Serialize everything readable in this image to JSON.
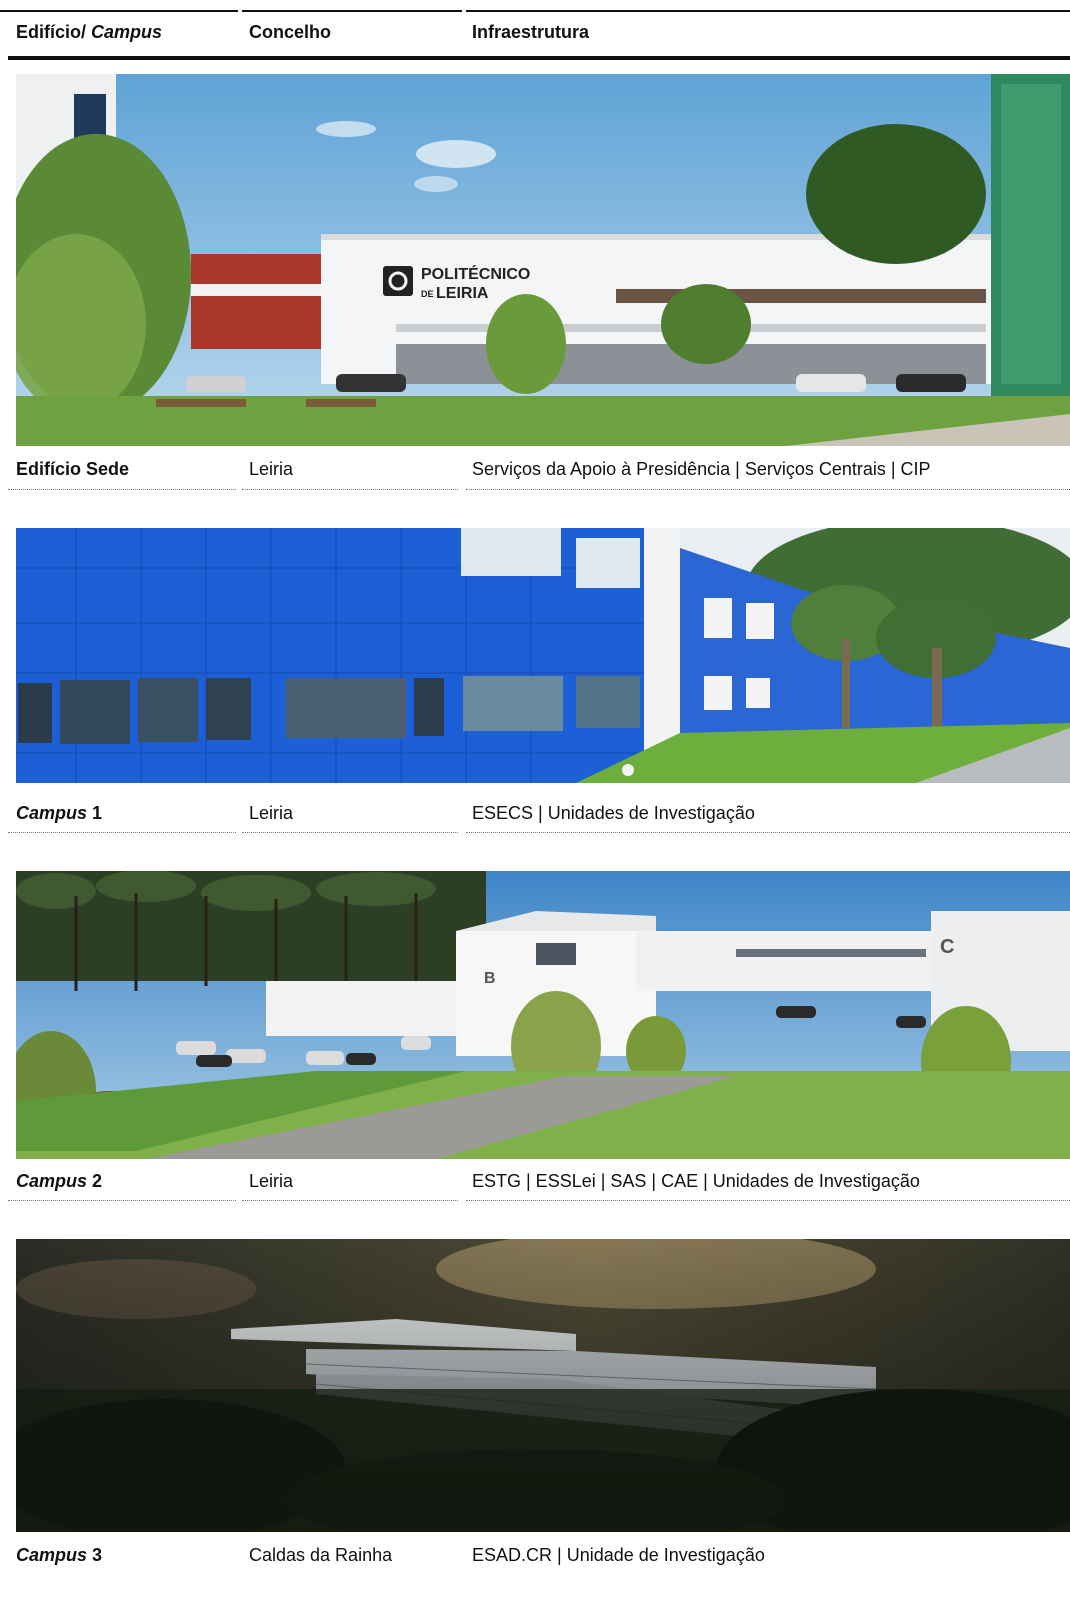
{
  "header": {
    "col1_plain": "Edifício/ ",
    "col1_italic": "Campus",
    "col2": "Concelho",
    "col3": "Infraestrutura"
  },
  "rows": [
    {
      "name_italic": "",
      "name_plain": "Edifício Sede",
      "concelho": "Leiria",
      "infra": "Serviços da Apoio à Presidência | Serviços Centrais | CIP",
      "sign_line1": "POLITÉCNICO",
      "sign_line2_small": "DE",
      "sign_line2": "LEIRIA"
    },
    {
      "name_italic": "Campus",
      "name_plain": " 1",
      "concelho": "Leiria",
      "infra": "ESECS | Unidades de Investigação"
    },
    {
      "name_italic": "Campus",
      "name_plain": " 2",
      "concelho": "Leiria",
      "infra": "ESTG | ESSLei | SAS | CAE | Unidades de Investigação",
      "bldg_b": "B",
      "bldg_c": "C"
    },
    {
      "name_italic": "Campus",
      "name_plain": " 3",
      "concelho": "Caldas da Rainha",
      "infra": "ESAD.CR | Unidade de Investigação"
    }
  ],
  "colors": {
    "rule": "#111111",
    "sky": "#7fb6dc",
    "grass": "#5f9a3a",
    "blue_facade": "#1c5fd6"
  }
}
